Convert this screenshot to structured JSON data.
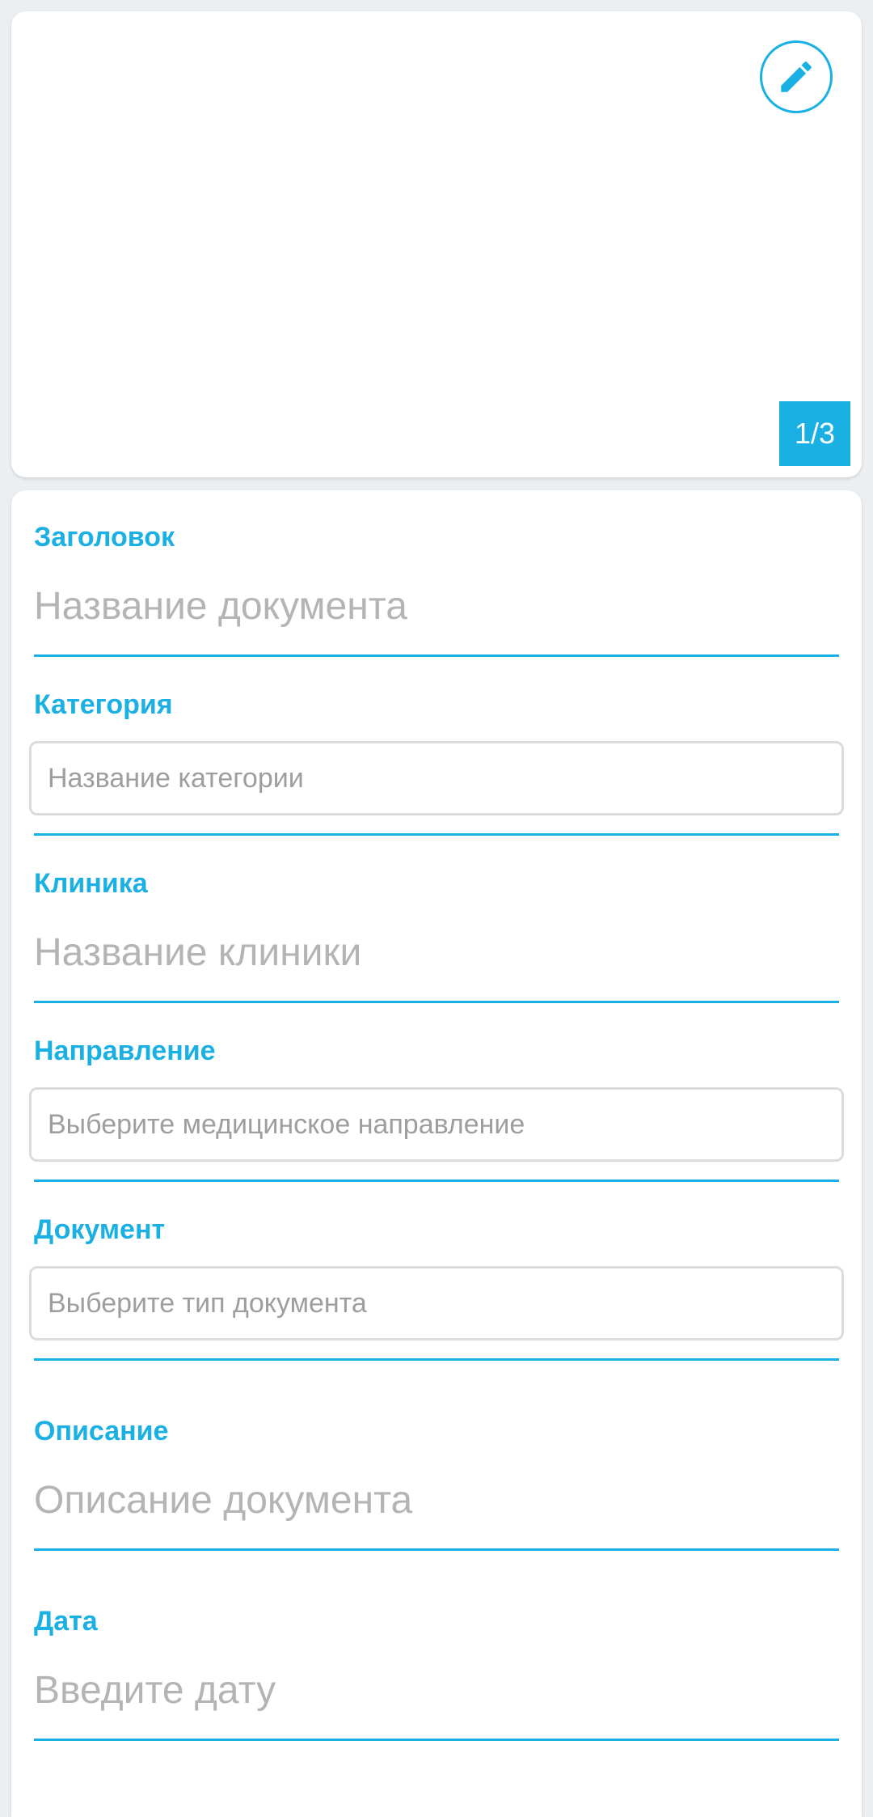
{
  "preview": {
    "counter": "1/3",
    "edit_icon": "pencil-icon",
    "accent_color": "#1ab0e4"
  },
  "form": {
    "title": {
      "label": "Заголовок",
      "placeholder": "Название документа"
    },
    "category": {
      "label": "Категория",
      "placeholder": "Название категории"
    },
    "clinic": {
      "label": "Клиника",
      "placeholder": "Название клиники"
    },
    "direction": {
      "label": "Направление",
      "placeholder": "Выберите медицинское направление"
    },
    "document": {
      "label": "Документ",
      "placeholder": "Выберите тип документа"
    },
    "description": {
      "label": "Описание",
      "placeholder": "Описание документа"
    },
    "date": {
      "label": "Дата",
      "placeholder": "Введите дату"
    }
  }
}
